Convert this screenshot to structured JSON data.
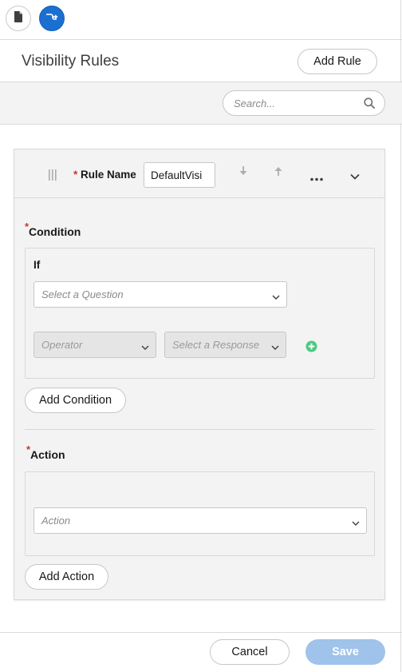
{
  "toolbar": {
    "doc_icon": "document-icon",
    "flow_icon": "flow-icon"
  },
  "header": {
    "title": "Visibility Rules",
    "add_rule_label": "Add Rule"
  },
  "search": {
    "placeholder": "Search..."
  },
  "rule": {
    "name_label": "Rule Name",
    "name_value": "DefaultVisi"
  },
  "condition": {
    "label": "Condition",
    "if_label": "If",
    "question_placeholder": "Select a Question",
    "operator_placeholder": "Operator",
    "response_placeholder": "Select a Response",
    "add_condition_label": "Add Condition"
  },
  "action": {
    "label": "Action",
    "action_placeholder": "Action",
    "add_action_label": "Add Action"
  },
  "footer": {
    "cancel_label": "Cancel",
    "save_label": "Save"
  },
  "colors": {
    "brand_blue": "#1b6fd1",
    "save_disabled": "#9fc3ea",
    "required_red": "#c23934",
    "add_green": "#4bca81"
  }
}
